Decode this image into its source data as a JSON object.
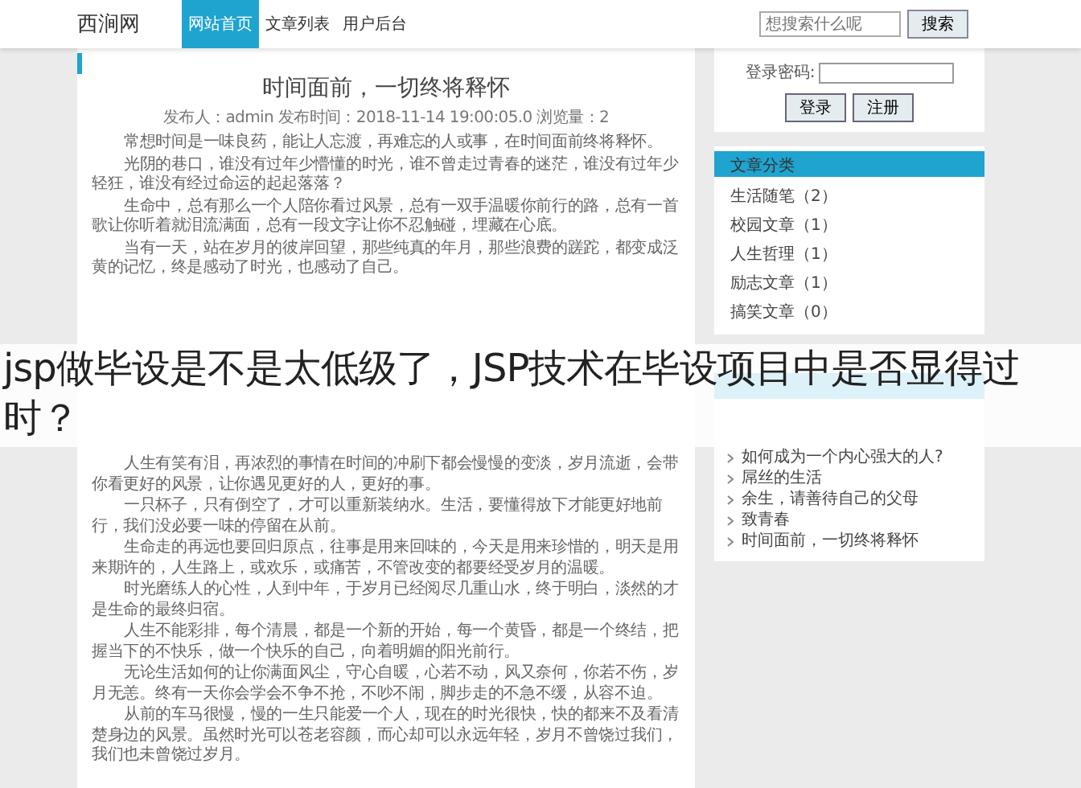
{
  "header": {
    "logo": "西涧网",
    "nav": [
      {
        "label": "网站首页",
        "selected": true
      },
      {
        "label": "文章列表",
        "selected": false
      },
      {
        "label": "用户后台",
        "selected": false
      }
    ],
    "search": {
      "placeholder": "想搜索什么呢",
      "button": "搜索"
    }
  },
  "article": {
    "title": "时间面前，一切终将释怀",
    "meta": "发布人：admin  发布时间：2018-11-14 19:00:05.0  浏览量：2",
    "paragraphs_before": [
      "常想时间是一味良药，能让人忘渡，再难忘的人或事，在时间面前终将释怀。",
      "光阴的巷口，谁没有过年少懵懂的时光，谁不曾走过青春的迷茫，谁没有过年少轻狂，谁没有经过命运的起起落落？",
      "生命中，总有那么一个人陪你看过风景，总有一双手温暖你前行的路，总有一首歌让你听着就泪流满面，总有一段文字让你不忍触碰，埋藏在心底。",
      "当有一天，站在岁月的彼岸回望，那些纯真的年月，那些浪费的蹉跎，都变成泛黄的记忆，终是感动了时光，也感动了自己。"
    ],
    "paragraphs_after": [
      "人生有笑有泪，再浓烈的事情在时间的冲刷下都会慢慢的变淡，岁月流逝，会带你看更好的风景，让你遇见更好的人，更好的事。",
      "一只杯子，只有倒空了，才可以重新装纳水。生活，要懂得放下才能更好地前行，我们没必要一味的停留在从前。",
      "生命走的再远也要回归原点，往事是用来回味的，今天是用来珍惜的，明天是用来期许的，人生路上，或欢乐，或痛苦，不管改变的都要经受岁月的温暖。",
      "时光磨练人的心性，人到中年，于岁月已经阅尽几重山水，终于明白，淡然的才是生命的最终归宿。",
      "人生不能彩排，每个清晨，都是一个新的开始，每一个黄昏，都是一个终结，把握当下的不快乐，做一个快乐的自己，向着明媚的阳光前行。",
      "无论生活如何的让你满面风尘，守心自暖，心若不动，风又奈何，你若不伤，岁月无恙。终有一天你会学会不争不抢，不吵不闹，脚步走的不急不缓，从容不迫。",
      "从前的车马很慢，慢的一生只能爱一个人，现在的时光很快，快的都来不及看清楚身边的风景。虽然时光可以苍老容颜，而心却可以永远年轻，岁月不曾饶过我们，我们也未曾饶过岁月。"
    ]
  },
  "caption": "jsp做毕设是不是太低级了，JSP技术在毕设项目中是否显得过时？",
  "sidebar": {
    "login": {
      "password_label": "登录密码:",
      "buttons": [
        "登录",
        "注册"
      ]
    },
    "categories": {
      "title": "文章分类",
      "items": [
        "生活随笔（2）",
        "校园文章（1）",
        "人生哲理（1）",
        "励志文章（1）",
        "搞笑文章（0）"
      ]
    },
    "recent": {
      "items": [
        "如何成为一个内心强大的人?",
        "屌丝的生活",
        "余生，请善待自己的父母",
        "致青春",
        "时间面前，一切终将释怀"
      ]
    }
  }
}
